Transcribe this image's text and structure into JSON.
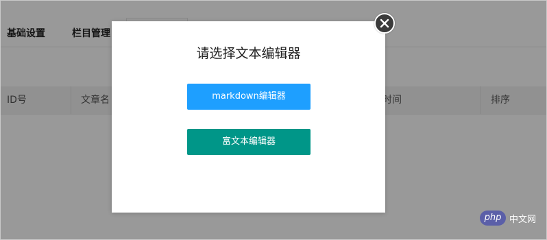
{
  "tabs": [
    {
      "label": "基础设置"
    },
    {
      "label": "栏目管理"
    },
    {
      "label": ""
    }
  ],
  "table": {
    "columns": [
      {
        "label": "ID号"
      },
      {
        "label": "文章名"
      },
      {
        "label": "添加时间"
      },
      {
        "label": "排序"
      }
    ]
  },
  "modal": {
    "title": "请选择文本编辑器",
    "markdown_button": "markdown编辑器",
    "richtext_button": "富文本编辑器",
    "close_icon": "close-icon"
  },
  "watermark": {
    "logo_text": "php",
    "site_text": "中文网"
  },
  "colors": {
    "markdown_button": "#1e9fff",
    "richtext_button": "#009688",
    "overlay": "rgba(0,0,0,0.4)",
    "watermark": "#5b5fa8"
  }
}
